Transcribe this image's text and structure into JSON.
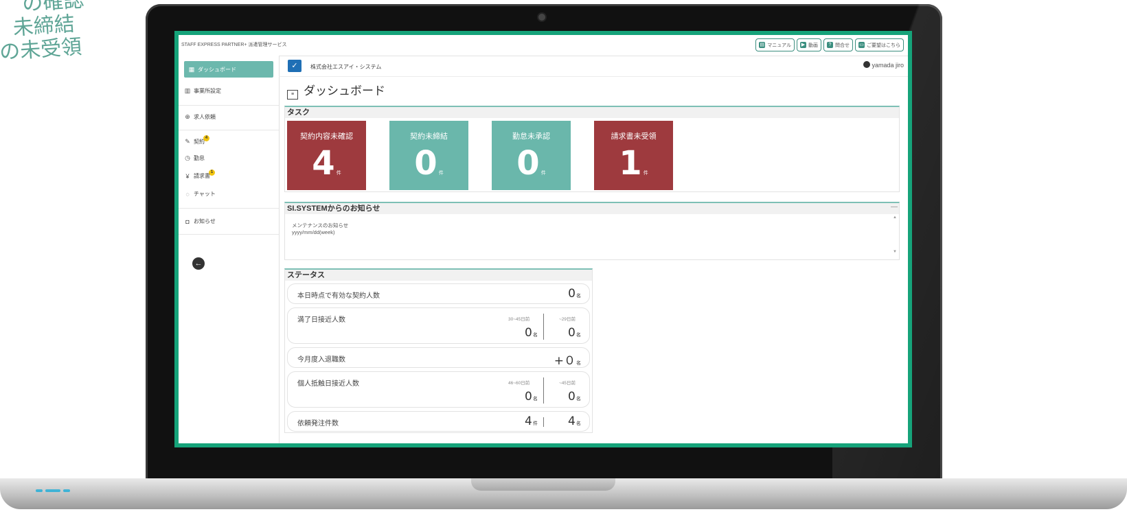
{
  "deco_lines": [
    "の確認",
    "未締結",
    "の未受領"
  ],
  "app": {
    "brand": "STAFF EXPRESS PARTNER+ 派遣管理サービス",
    "top_buttons": [
      {
        "label": "マニュアル",
        "icon": "book-icon"
      },
      {
        "label": "動画",
        "icon": "video-icon"
      },
      {
        "label": "問合せ",
        "icon": "question-icon"
      },
      {
        "label": "ご要望はこちら",
        "icon": "comment-icon"
      }
    ],
    "company": "株式会社エスアイ・システム",
    "user": "yamada jiro",
    "page_title": "ダッシュボード"
  },
  "sidebar": {
    "items": [
      {
        "label": "ダッシュボード",
        "icon": "dashboard-icon",
        "active": true
      },
      {
        "label": "事業所設定",
        "icon": "building-icon"
      },
      {
        "label": "求人依頼",
        "icon": "search-person-icon"
      },
      {
        "label": "契約",
        "icon": "pen-icon",
        "badge": "4"
      },
      {
        "label": "勤怠",
        "icon": "clock-icon"
      },
      {
        "label": "請求書",
        "icon": "yen-icon",
        "badge": "1"
      },
      {
        "label": "チャット",
        "icon": "chat-icon"
      },
      {
        "label": "お知らせ",
        "icon": "notice-icon"
      }
    ],
    "back_icon": "arrow-left-icon"
  },
  "tasks": {
    "title": "タスク",
    "tiles": [
      {
        "label": "契約内容未確認",
        "value": "4",
        "unit": "件",
        "color": "#9e3a3e"
      },
      {
        "label": "契約未締結",
        "value": "0",
        "unit": "件",
        "color": "#6ab7ab"
      },
      {
        "label": "勤怠未承認",
        "value": "0",
        "unit": "件",
        "color": "#6ab7ab"
      },
      {
        "label": "請求書未受領",
        "value": "1",
        "unit": "件",
        "color": "#9e3a3e"
      }
    ]
  },
  "news": {
    "title": "SI.SYSTEMからのお知らせ",
    "collapse": "—",
    "item_title": "メンテナンスのお知らせ",
    "item_date": "yyyy/mm/dd(week)"
  },
  "status": {
    "title": "ステータス",
    "rows": [
      {
        "label": "本日時点で有効な契約人数",
        "value": "0",
        "unit": "名"
      },
      {
        "label": "満了日接近人数",
        "col1": "30~45日前",
        "col2": "~29日前",
        "v1": "0",
        "v2": "0",
        "unit": "名"
      },
      {
        "label": "今月度入退職数",
        "value": "+０",
        "unit": "名"
      },
      {
        "label": "個人抵触日接近人数",
        "col1": "46~60日前",
        "col2": "~45日前",
        "v1": "0",
        "v2": "0",
        "unit": "名"
      },
      {
        "label": "依頼発注件数",
        "v1": "4",
        "u1": "件",
        "v2": "4",
        "u2": "名"
      }
    ]
  }
}
